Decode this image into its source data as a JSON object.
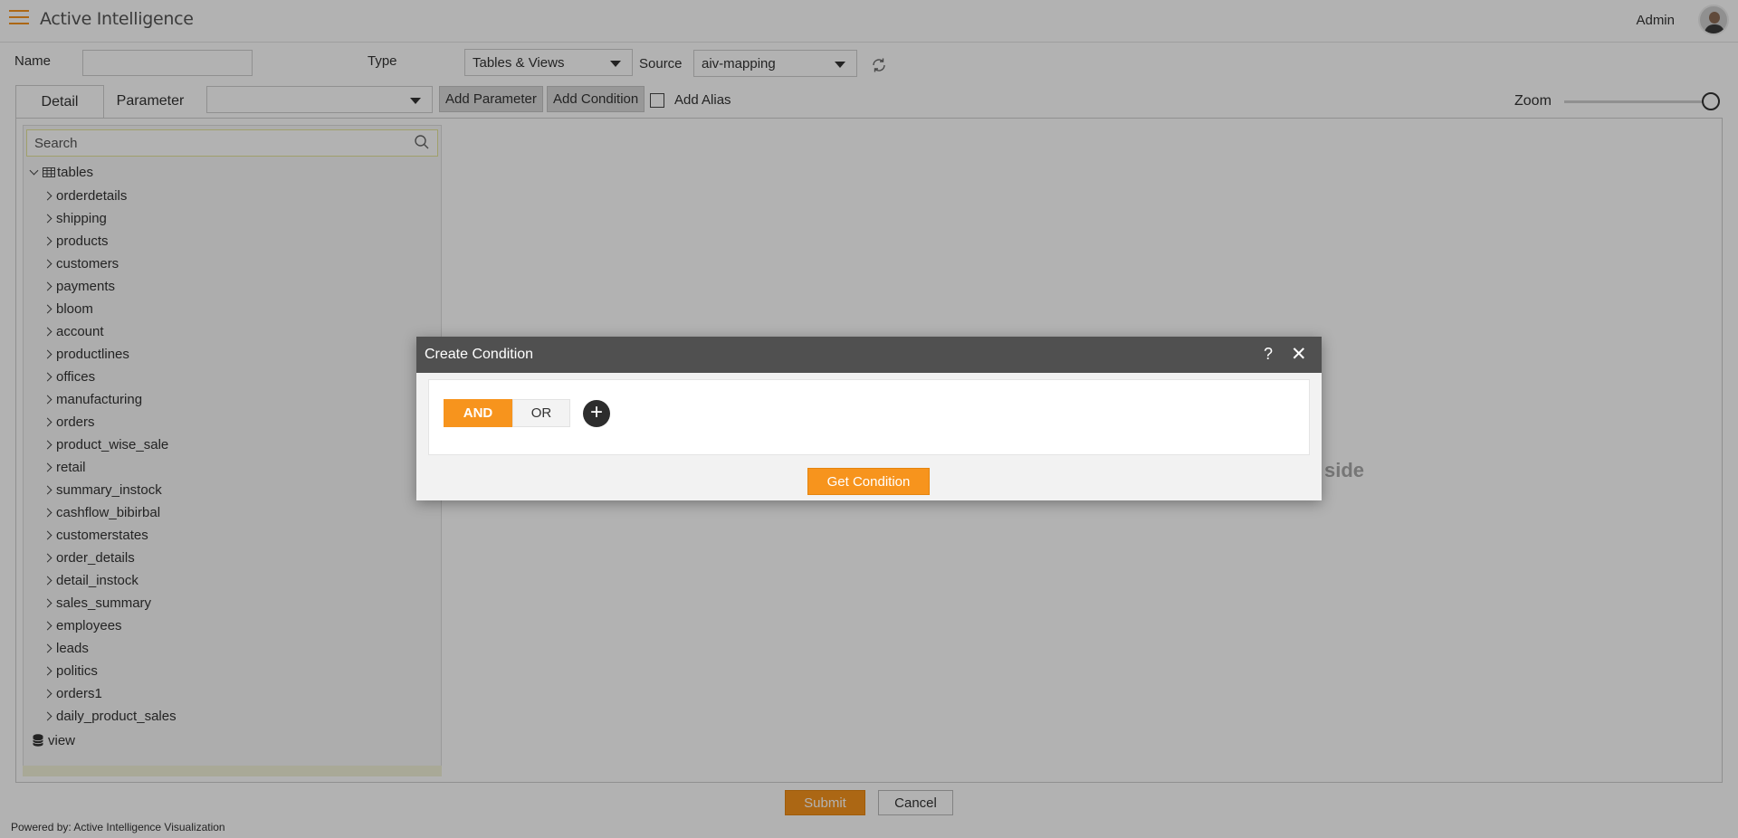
{
  "header": {
    "app_title": "Active Intelligence",
    "user_name": "Admin"
  },
  "form": {
    "name_label": "Name",
    "name_value": "",
    "type_label": "Type",
    "type_value": "Tables & Views",
    "source_label": "Source",
    "source_value": "aiv-mapping"
  },
  "toolbar": {
    "tabs": [
      "Detail",
      "Parameter"
    ],
    "parameter_select_value": "",
    "add_parameter": "Add Parameter",
    "add_condition": "Add Condition",
    "add_alias": "Add Alias",
    "add_alias_checked": false,
    "zoom_label": "Zoom",
    "zoom_level": 1.0
  },
  "tree": {
    "search_placeholder": "Search",
    "root_label": "tables",
    "items": [
      "orderdetails",
      "shipping",
      "products",
      "customers",
      "payments",
      "bloom",
      "account",
      "productlines",
      "offices",
      "manufacturing",
      "orders",
      "product_wise_sale",
      "retail",
      "summary_instock",
      "cashflow_bibirbal",
      "customerstates",
      "order_details",
      "detail_instock",
      "sales_summary",
      "employees",
      "leads",
      "politics",
      "orders1",
      "daily_product_sales"
    ],
    "view_label": "view"
  },
  "canvas": {
    "hint_text": "side"
  },
  "actions": {
    "submit": "Submit",
    "cancel": "Cancel"
  },
  "footer": {
    "text": "Powered by: Active Intelligence Visualization"
  },
  "modal": {
    "title": "Create Condition",
    "help": "?",
    "close": "✕",
    "and_label": "AND",
    "or_label": "OR",
    "add_label": "+",
    "get_condition": "Get Condition"
  },
  "colors": {
    "accent": "#f7941d",
    "modal_header": "#505050",
    "overlay": "rgba(0,0,0,0.3)"
  }
}
